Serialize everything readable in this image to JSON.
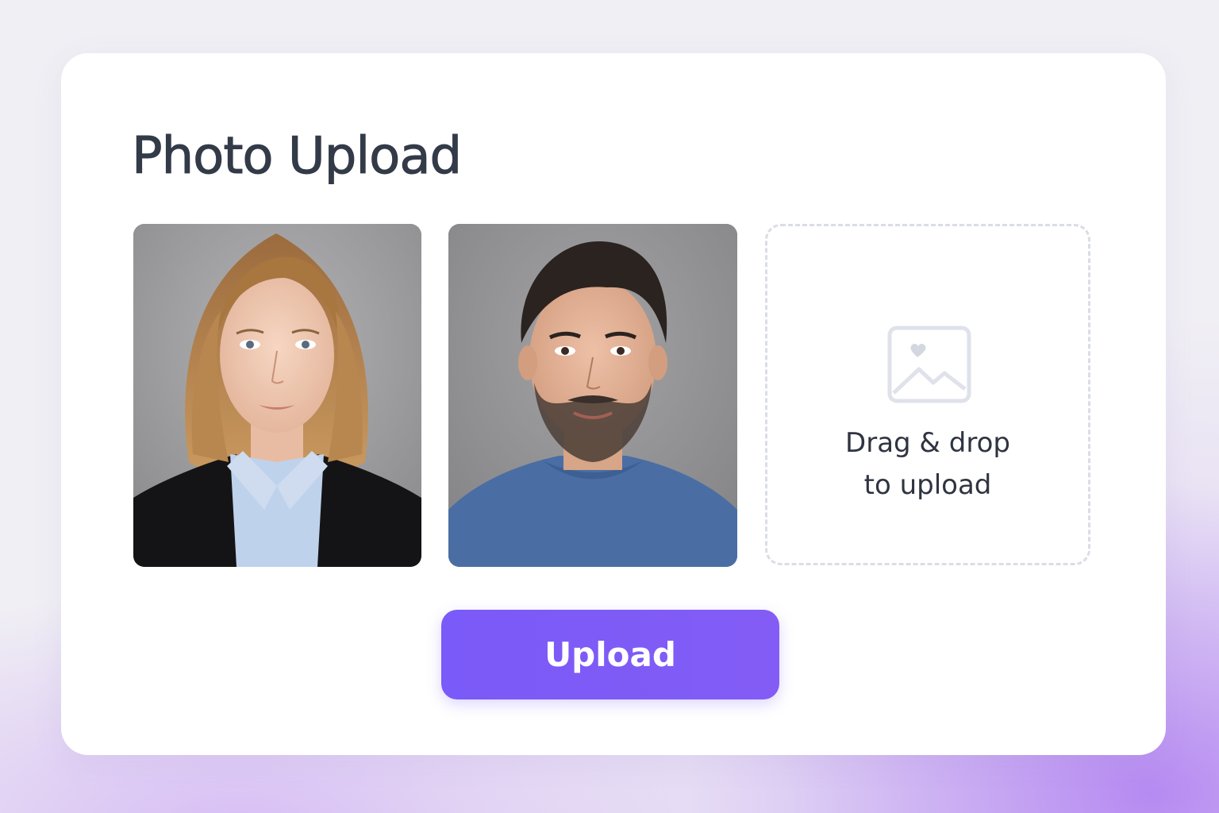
{
  "page": {
    "title": "Photo Upload"
  },
  "photos": [
    {
      "subject": "woman-portrait",
      "background": "#9a9a9c",
      "clothing": "#151517",
      "shirt": "#bcd0ec",
      "hair": "#b58450"
    },
    {
      "subject": "man-portrait",
      "background": "#8e8e90",
      "clothing": "#4a6ea4",
      "hair": "#2b2320"
    }
  ],
  "dropzone": {
    "text": "Drag & drop\nto upload",
    "icon": "image-icon",
    "border_color": "#dadde5"
  },
  "upload_button": {
    "label": "Upload",
    "color": "#7a5af8"
  },
  "colors": {
    "title": "#333a48",
    "accent": "#7a5af8",
    "card": "#ffffff"
  }
}
